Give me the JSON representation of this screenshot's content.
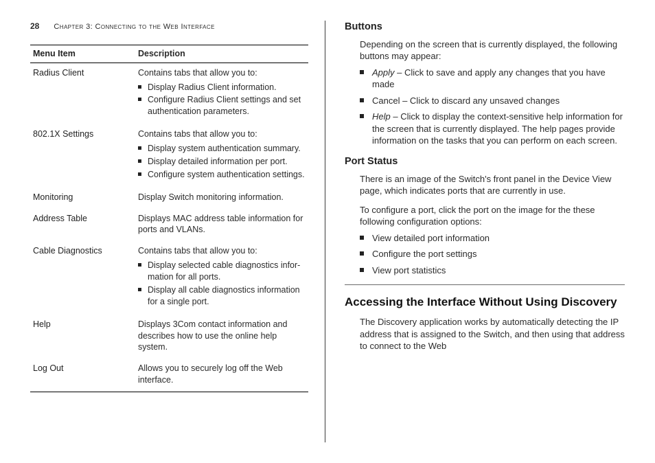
{
  "header": {
    "page_number": "28",
    "chapter_label": "Chapter 3: Connecting to the Web Interface"
  },
  "menu_table": {
    "head_item": "Menu Item",
    "head_desc": "Description",
    "rows": [
      {
        "item": "Radius Client",
        "intro": "Contains tabs that allow you to:",
        "bullets": [
          "Display Radius Client information.",
          "Configure Radius Client settings and set authentication parameters."
        ],
        "indent": 1
      },
      {
        "item": "802.1X Settings",
        "intro": "Contains tabs that allow you to:",
        "bullets": [
          "Display system authentication summary.",
          "Display detailed information per port.",
          "Configure system authentication set­tings."
        ],
        "indent": 1
      },
      {
        "item": "Monitoring",
        "intro": "Display Switch monitoring information.",
        "bullets": [],
        "indent": 0
      },
      {
        "item": "Address Table",
        "intro": "Displays MAC address table information for ports and VLANs.",
        "bullets": [],
        "indent": 1
      },
      {
        "item": "Cable Diagnostics",
        "intro": "Contains tabs that allow you to:",
        "bullets": [
          "Display selected cable diagnostics infor­mation for all ports.",
          "Display all cable diagnostics information for a single port."
        ],
        "indent": 1
      },
      {
        "item": "Help",
        "intro": "Displays 3Com contact information and describes how to use the online help system.",
        "bullets": [],
        "indent": 0
      },
      {
        "item": "Log Out",
        "intro": "Allows you to securely log off the Web interface.",
        "bullets": [],
        "indent": 0
      }
    ]
  },
  "right": {
    "buttons_heading": "Buttons",
    "buttons_intro": "Depending on the screen that is currently displayed, the following buttons may appear:",
    "buttons_list": [
      {
        "term": "Apply",
        "sep": " – ",
        "text": "Click to save and apply any changes that you have made"
      },
      {
        "term": "",
        "sep": "",
        "text": "Cancel – Click to discard any unsaved changes"
      },
      {
        "term": "Help",
        "sep": " – ",
        "text": "Click to display the context-sensitive help information for the screen that is currently displayed. The help pages provide information on the tasks that you can perform on each screen."
      }
    ],
    "port_heading": "Port Status",
    "port_p1": "There is an image of the Switch's front panel in the Device View page, which indicates ports that are currently in use.",
    "port_p2": "To configure a port, click the port on the image for the these following configuration options:",
    "port_list": [
      "View detailed port information",
      "Configure the port settings",
      "View port statistics"
    ],
    "section_heading": "Accessing the Interface Without Using Discovery",
    "section_p1": "The Discovery application works by automatically detecting the IP address that is assigned to the Switch, and then using that address to connect to the Web"
  }
}
